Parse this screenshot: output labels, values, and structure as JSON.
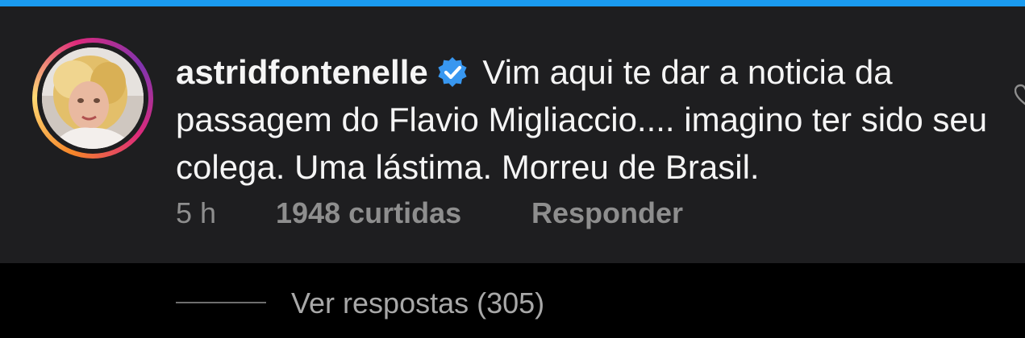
{
  "comment": {
    "username": "astridfontenelle",
    "verified_icon": "verified-badge-icon",
    "text": "Vim aqui te dar a noticia da passagem do Flavio Migliaccio.... imagino ter sido seu colega. Uma lástima. Morreu de Brasil.",
    "time": "5 h",
    "likes": "1948 curtidas",
    "reply_label": "Responder",
    "like_icon": "heart-outline-icon"
  },
  "replies": {
    "label": "Ver respostas (305)"
  },
  "colors": {
    "top_accent": "#1a9bf0",
    "card_background": "#1e1e20",
    "page_background": "#000000",
    "text_primary": "#f5f5f5",
    "text_secondary": "#8e8e8e",
    "verified_blue": "#3897f0"
  }
}
